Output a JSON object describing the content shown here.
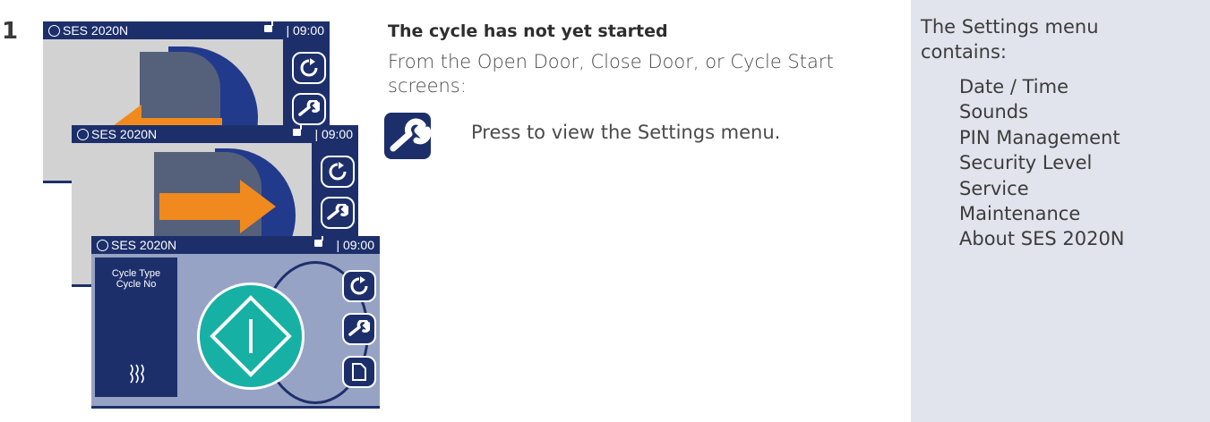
{
  "step_number": "1",
  "screens": [
    {
      "model": "SES 2020N",
      "time": "| 09:00"
    },
    {
      "model": "SES 2020N",
      "time": "| 09:00"
    },
    {
      "model": "SES 2020N",
      "time": "| 09:00",
      "cycle_type": "Cycle Type",
      "cycle_no": "Cycle No"
    }
  ],
  "content": {
    "heading": "The cycle has not yet started",
    "paragraph": "From the Open Door, Close Door, or Cycle Start screens:",
    "press_text": "Press to view the Settings menu."
  },
  "sidebar": {
    "intro": "The Settings menu contains:",
    "items": [
      "Date / Time",
      "Sounds",
      "PIN Management",
      "Security Level",
      "Service",
      "Maintenance",
      "About SES 2020N"
    ]
  },
  "colors": {
    "navy": "#1d2f6b",
    "teal": "#17b0a4",
    "orange": "#f08a1e",
    "sidebar_bg": "#e1e4ec"
  },
  "icons": [
    "refresh-icon",
    "wrench-icon",
    "document-icon",
    "lock-open-icon",
    "steam-icon",
    "start-icon"
  ]
}
